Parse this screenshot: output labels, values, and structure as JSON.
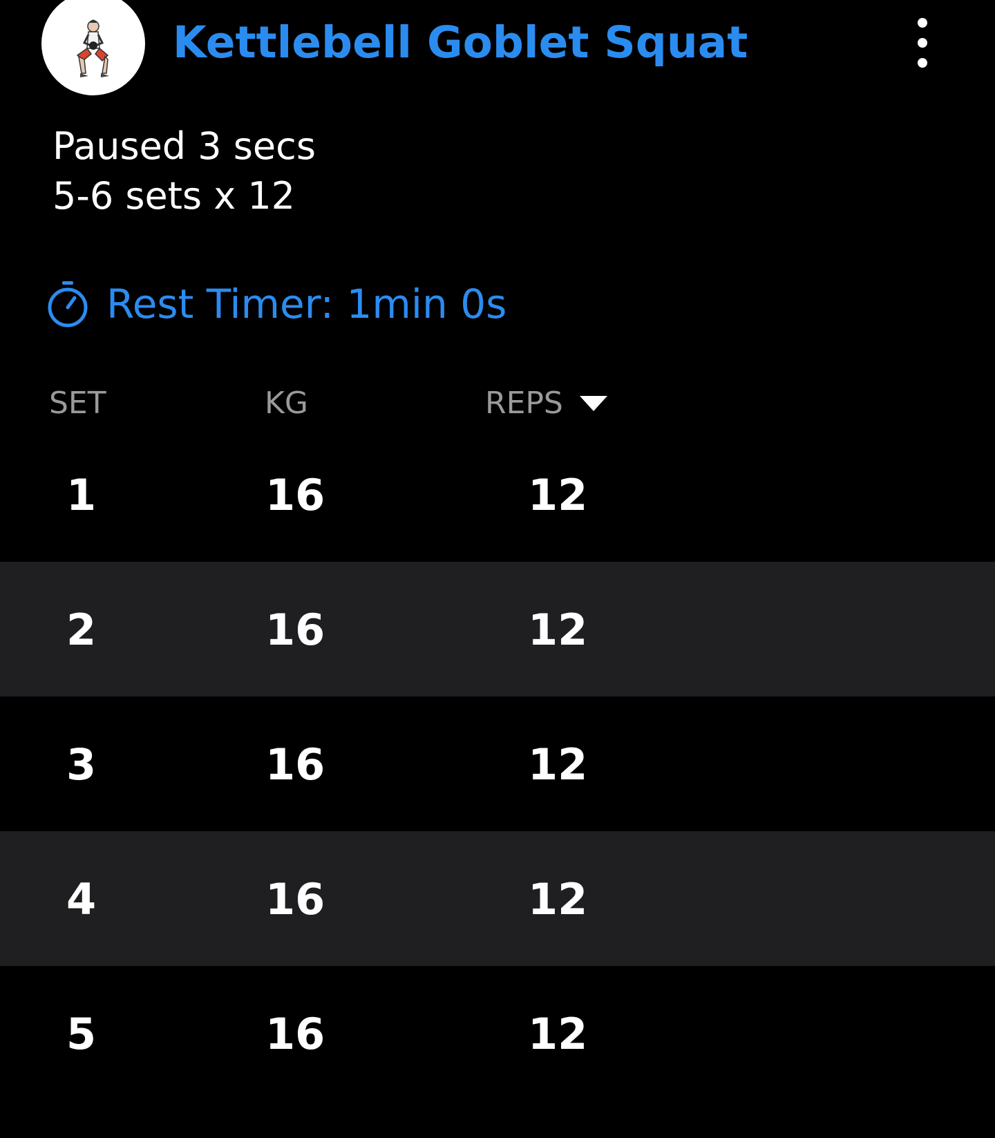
{
  "header": {
    "title": "Kettlebell Goblet Squat",
    "avatar_icon": "squat-figure-icon",
    "menu_icon": "more-vertical-icon"
  },
  "notes": {
    "line1": "Paused 3 secs",
    "line2": "5-6 sets x 12"
  },
  "rest_timer": {
    "icon": "stopwatch-icon",
    "label": "Rest Timer: 1min 0s"
  },
  "table": {
    "columns": {
      "set": "SET",
      "kg": "KG",
      "reps": "REPS"
    },
    "rows": [
      {
        "set": "1",
        "kg": "16",
        "reps": "12"
      },
      {
        "set": "2",
        "kg": "16",
        "reps": "12"
      },
      {
        "set": "3",
        "kg": "16",
        "reps": "12"
      },
      {
        "set": "4",
        "kg": "16",
        "reps": "12"
      },
      {
        "set": "5",
        "kg": "16",
        "reps": "12"
      }
    ]
  },
  "colors": {
    "accent": "#2b8cf0",
    "background": "#000000",
    "alt_row": "#1f1f21",
    "header_text": "#9a9a9a"
  }
}
